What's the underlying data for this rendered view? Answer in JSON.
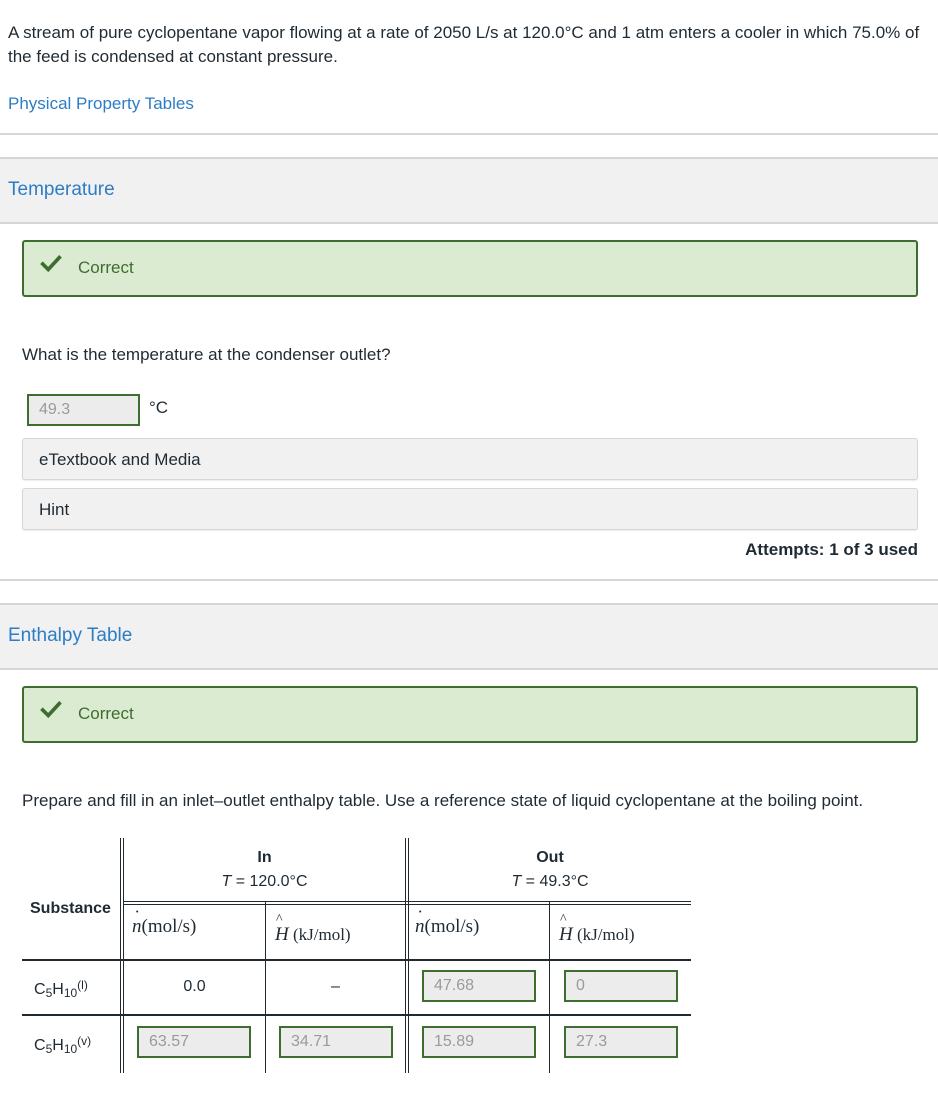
{
  "problem": {
    "statement": "A stream of pure cyclopentane vapor flowing at a rate of 2050 L/s at 120.0°C and 1 atm enters a cooler in which 75.0% of the feed is condensed at constant pressure.",
    "physical_property_link": "Physical Property Tables"
  },
  "sections": {
    "temperature": {
      "title": "Temperature",
      "status": "Correct",
      "question": "What is the temperature at the condenser outlet?",
      "answer_value": "49.3",
      "answer_unit": "°C",
      "etextbook_label": "eTextbook and Media",
      "hint_label": "Hint",
      "attempts": "Attempts: 1 of 3 used"
    },
    "enthalpy": {
      "title": "Enthalpy Table",
      "status": "Correct",
      "question": "Prepare and fill in an inlet–outlet enthalpy table. Use a reference state of liquid cyclopentane at the boiling point."
    }
  },
  "table": {
    "substance_header": "Substance",
    "in": {
      "label": "In",
      "temp_var": "T",
      "temp_value": " = 120.0°C"
    },
    "out": {
      "label": "Out",
      "temp_var": "T",
      "temp_value": " = 49.3°C"
    },
    "col_n_symbol": "n",
    "col_n_unit": "(mol/s)",
    "col_h_symbol": "H",
    "col_h_unit": " (kJ/mol)",
    "rows": [
      {
        "formula_c": "C",
        "sub1": "5",
        "formula_h": "H",
        "sub2": "10",
        "phase": "(l)",
        "n_in": "0.0",
        "h_in": "–",
        "n_out": "47.68",
        "h_out": "0"
      },
      {
        "formula_c": "C",
        "sub1": "5",
        "formula_h": "H",
        "sub2": "10",
        "phase": "(v)",
        "n_in": "63.57",
        "h_in": "34.71",
        "n_out": "15.89",
        "h_out": "27.3"
      }
    ]
  },
  "colors": {
    "link": "#2c7cc6",
    "correct_bg": "#dbebd1",
    "correct_border": "#3e6e2f"
  }
}
